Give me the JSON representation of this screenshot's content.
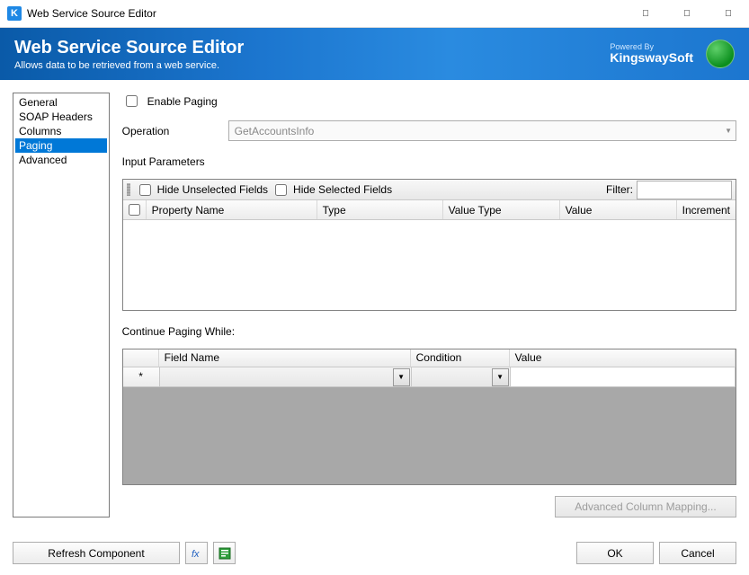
{
  "window": {
    "title": "Web Service Source Editor"
  },
  "header": {
    "title": "Web Service Source Editor",
    "subtitle": "Allows data to be retrieved from a web service.",
    "powered_by_label": "Powered By",
    "brand": "KingswaySoft"
  },
  "sidebar": {
    "items": [
      {
        "label": "General",
        "selected": false
      },
      {
        "label": "SOAP Headers",
        "selected": false
      },
      {
        "label": "Columns",
        "selected": false
      },
      {
        "label": "Paging",
        "selected": true
      },
      {
        "label": "Advanced",
        "selected": false
      }
    ]
  },
  "paging_tab": {
    "enable_paging_label": "Enable Paging",
    "enable_paging_checked": false,
    "operation_label": "Operation",
    "operation_value": "GetAccountsInfo",
    "input_parameters_title": "Input Parameters",
    "hide_unselected_label": "Hide Unselected Fields",
    "hide_selected_label": "Hide Selected Fields",
    "filter_label": "Filter:",
    "filter_value": "",
    "columns": {
      "property_name": "Property Name",
      "type": "Type",
      "value_type": "Value Type",
      "value": "Value",
      "increment": "Increment"
    },
    "continue_paging_title": "Continue Paging While:",
    "cp_columns": {
      "field_name": "Field Name",
      "condition": "Condition",
      "value": "Value"
    },
    "cp_row_marker": "*",
    "advanced_mapping_label": "Advanced Column Mapping..."
  },
  "footer": {
    "refresh_label": "Refresh Component",
    "ok_label": "OK",
    "cancel_label": "Cancel"
  }
}
